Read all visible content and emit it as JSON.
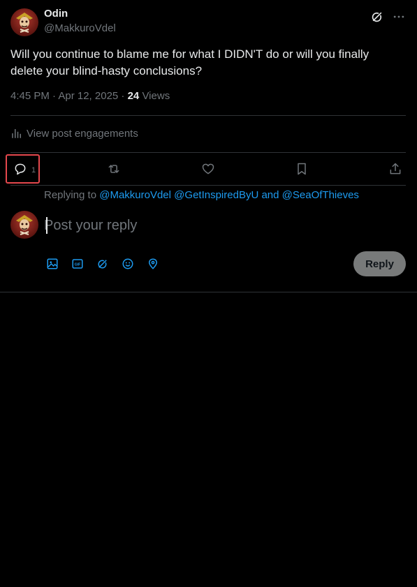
{
  "author": {
    "name": "Odin",
    "handle": "@MakkuroVdel",
    "avatar_icon": "jolly-roger-avatar"
  },
  "post": {
    "text": "Will you continue to blame me for what I DIDN'T do or will you finally delete your blind-hasty conclusions?",
    "timestamp": "4:45 PM · Apr 12, 2025 · ",
    "views_count": "24",
    "views_label": " Views"
  },
  "engagements_label": "View post engagements",
  "actions": {
    "reply_count": "1",
    "icons": [
      "reply-icon",
      "repost-icon",
      "like-icon",
      "bookmark-icon",
      "share-icon"
    ]
  },
  "composer": {
    "replying_prefix": "Replying to ",
    "replying_handles": [
      "@MakkuroVdel",
      "@GetInspiredByU",
      "and",
      "@SeaOfThieves"
    ],
    "placeholder": "Post your reply",
    "button_label": "Reply",
    "tools": [
      "media-icon",
      "gif-icon",
      "grok-icon",
      "emoji-icon",
      "location-icon"
    ]
  },
  "colors": {
    "background": "#000000",
    "text": "#e7e9ea",
    "muted": "#71767b",
    "accent": "#1d9bf0",
    "highlight": "#e5484d",
    "reply_button_disabled": "#787a7a"
  }
}
